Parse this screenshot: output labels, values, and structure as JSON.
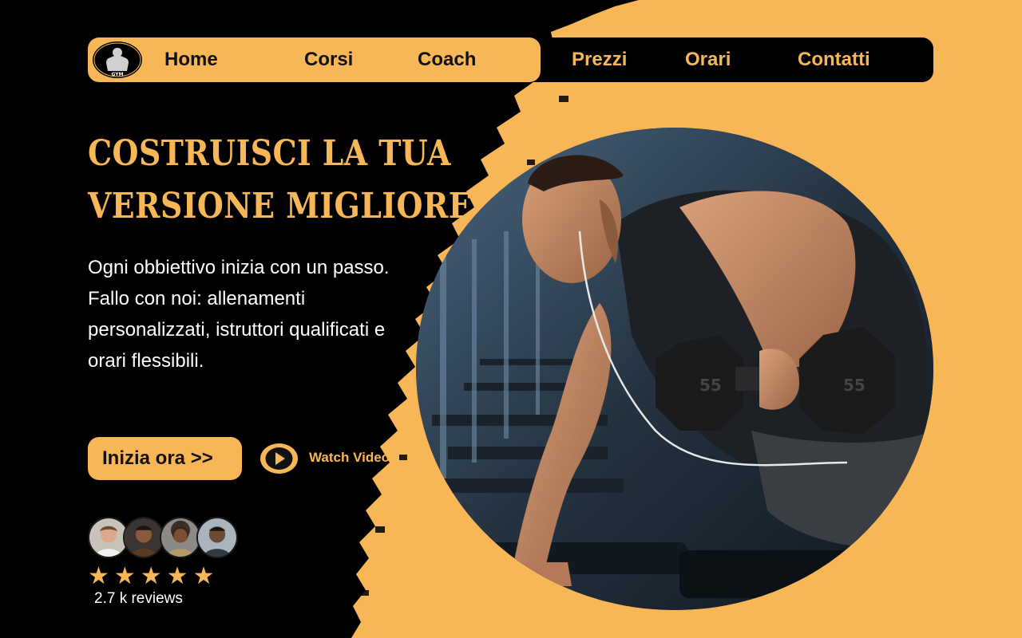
{
  "nav": {
    "links_on_pill": [
      "Home",
      "Corsi",
      "Coach"
    ],
    "links_on_dark": [
      "Prezzi",
      "Orari",
      "Contatti"
    ],
    "logo_icon": "gym-logo-icon"
  },
  "hero": {
    "headline_line1": "Costruisci la tua",
    "headline_line2": "versione migliore",
    "subtext": "Ogni obbiettivo inizia con un passo. Fallo con noi: allenamenti personalizzati, istruttori qualificati e orari flessibili.",
    "cta_label": "Inizia ora >>",
    "video_label": "Watch Video",
    "video_icon": "play-icon",
    "photo_icon": "athlete-dumbbell-photo"
  },
  "reviews": {
    "stars": "★★★★★",
    "rating": 5,
    "count_text": "2.7 k reviews",
    "avatar_icons": [
      "avatar-1",
      "avatar-2",
      "avatar-3",
      "avatar-4"
    ]
  },
  "colors": {
    "accent": "#F8B757",
    "background": "#000000",
    "text_light": "#FFFFFF",
    "text_dark": "#111111"
  }
}
